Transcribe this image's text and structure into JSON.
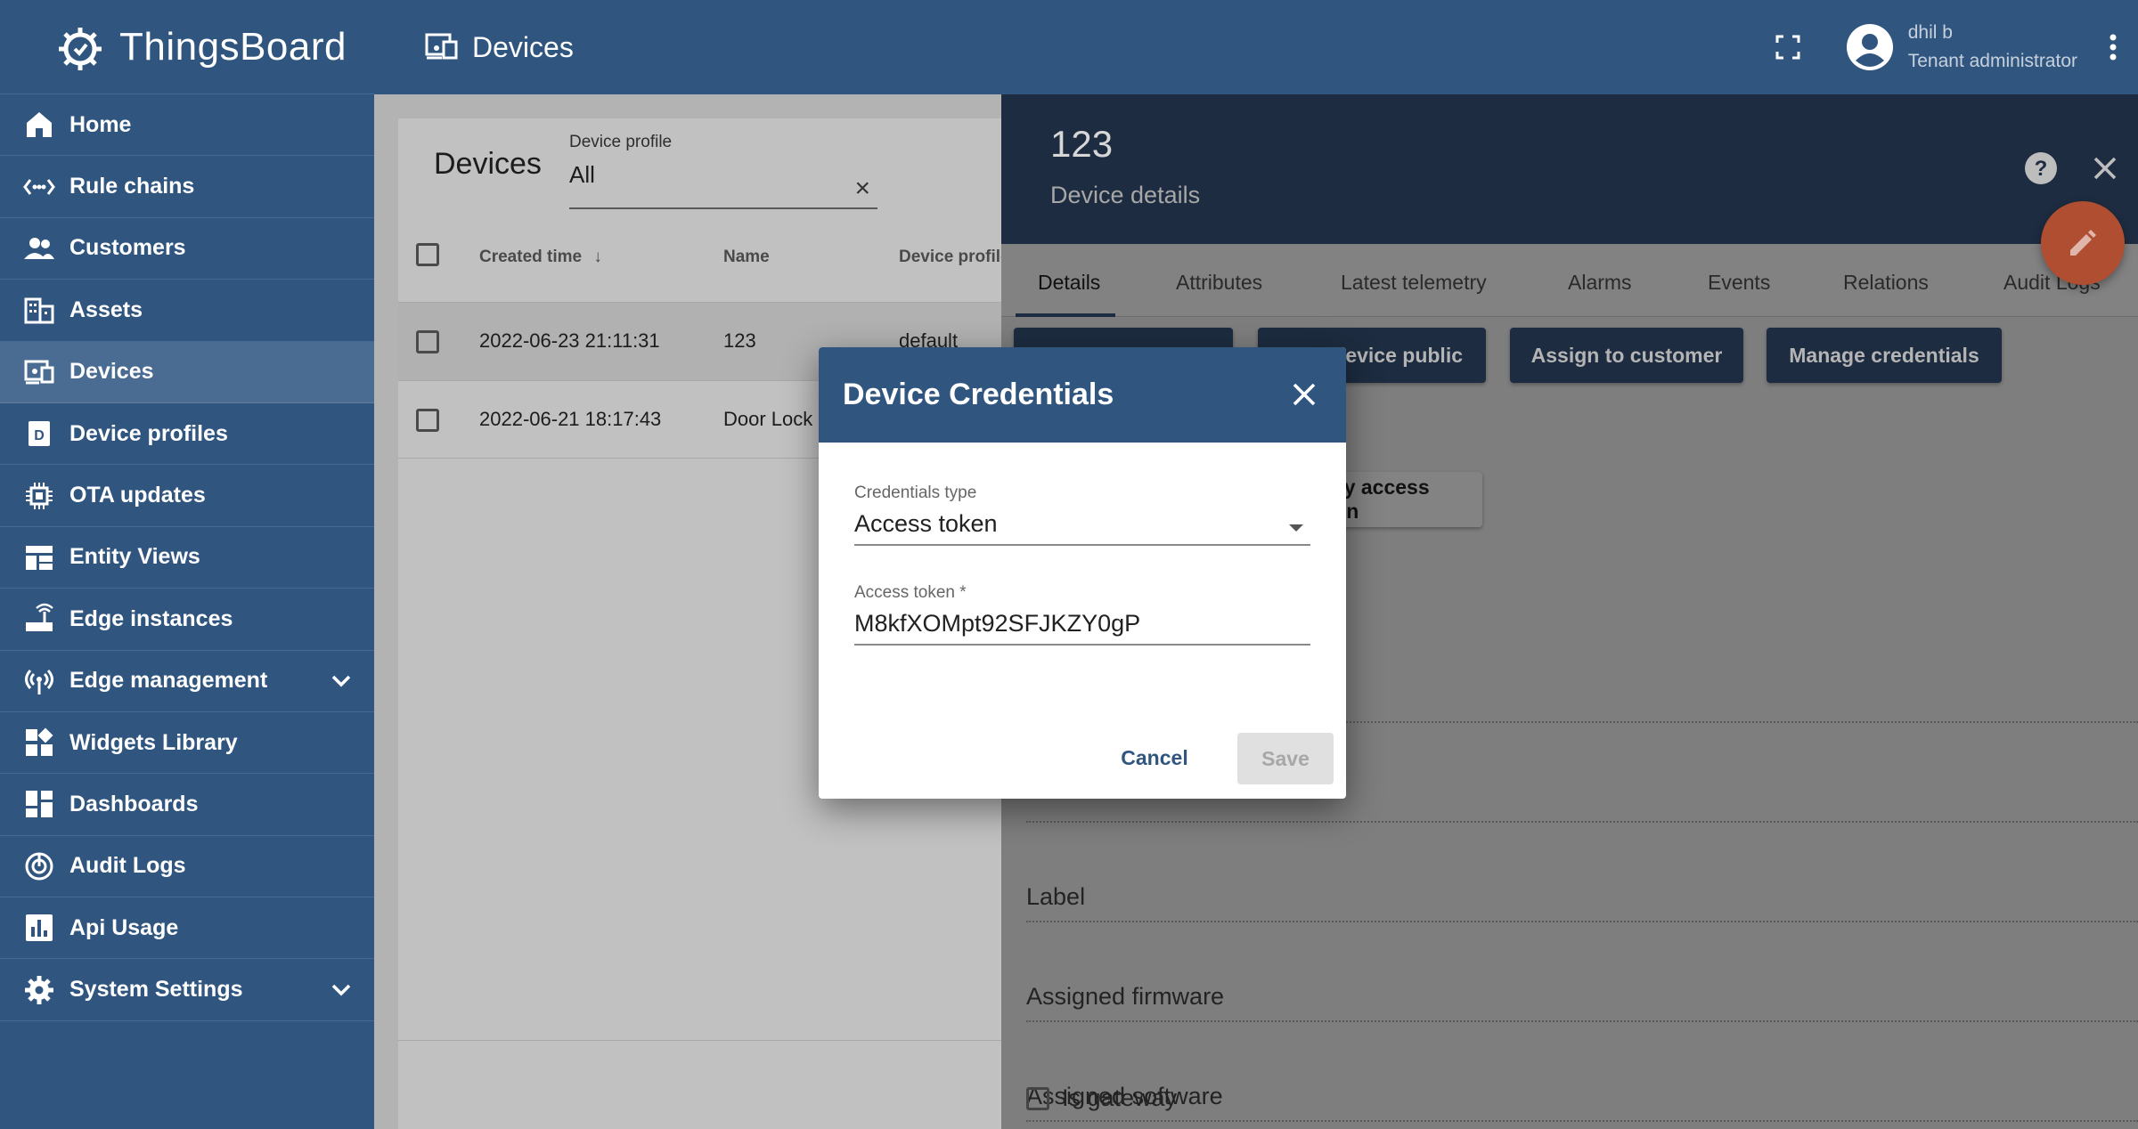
{
  "app": {
    "name": "ThingsBoard"
  },
  "sidebar": {
    "items": [
      {
        "label": "Home",
        "icon": "home-icon"
      },
      {
        "label": "Rule chains",
        "icon": "rule-chain-icon"
      },
      {
        "label": "Customers",
        "icon": "customers-icon"
      },
      {
        "label": "Assets",
        "icon": "assets-icon"
      },
      {
        "label": "Devices",
        "icon": "devices-icon",
        "active": true
      },
      {
        "label": "Device profiles",
        "icon": "device-profile-icon"
      },
      {
        "label": "OTA updates",
        "icon": "ota-icon"
      },
      {
        "label": "Entity Views",
        "icon": "entity-views-icon"
      },
      {
        "label": "Edge instances",
        "icon": "edge-instances-icon"
      },
      {
        "label": "Edge management",
        "icon": "edge-management-icon",
        "expandable": true
      },
      {
        "label": "Widgets Library",
        "icon": "widgets-icon"
      },
      {
        "label": "Dashboards",
        "icon": "dashboards-icon"
      },
      {
        "label": "Audit Logs",
        "icon": "audit-logs-icon"
      },
      {
        "label": "Api Usage",
        "icon": "api-usage-icon"
      },
      {
        "label": "System Settings",
        "icon": "settings-icon",
        "expandable": true
      }
    ]
  },
  "topbar": {
    "title": "Devices",
    "user": {
      "name": "dhil b",
      "role": "Tenant administrator"
    }
  },
  "list": {
    "title": "Devices",
    "filter": {
      "label": "Device profile",
      "value": "All"
    },
    "columns": {
      "created": "Created time",
      "name": "Name",
      "profile": "Device profile"
    },
    "rows": [
      {
        "created": "2022-06-23 21:11:31",
        "name": "123",
        "profile": "default"
      },
      {
        "created": "2022-06-21 18:17:43",
        "name": "Door Lock",
        "profile": ""
      }
    ]
  },
  "details": {
    "name": "123",
    "subtitle": "Device details",
    "tabs": [
      "Details",
      "Attributes",
      "Latest telemetry",
      "Alarms",
      "Events",
      "Relations",
      "Audit Logs"
    ],
    "actions": {
      "make_public": "Make device public",
      "assign": "Assign to customer",
      "manage": "Manage credentials",
      "copy_token": "Copy access token"
    },
    "fields": {
      "label": "Label",
      "firmware": "Assigned firmware",
      "software": "Assigned software",
      "gateway": "Is gateway"
    }
  },
  "dialog": {
    "title": "Device Credentials",
    "credentials_type": {
      "label": "Credentials type",
      "value": "Access token"
    },
    "access_token": {
      "label": "Access token *",
      "value": "M8kfXOMpt92SFJKZY0gP"
    },
    "cancel": "Cancel",
    "save": "Save"
  },
  "colors": {
    "primary": "#305680",
    "fab": "#b04e32"
  }
}
